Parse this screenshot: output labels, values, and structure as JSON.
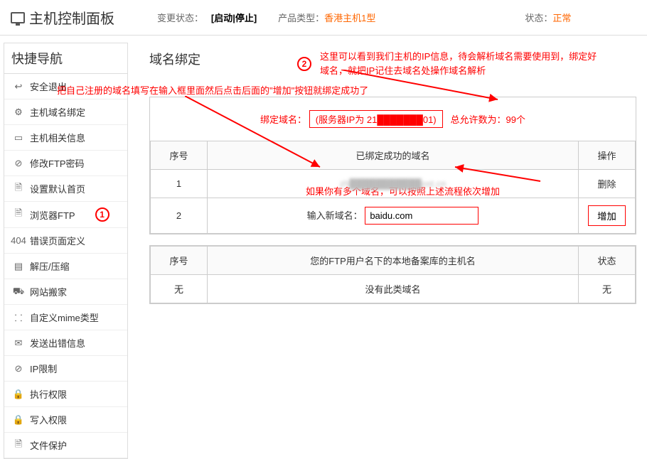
{
  "header": {
    "title": "主机控制面板",
    "change_label": "变更状态：",
    "change_value": "[启动|停止]",
    "ptype_label": "产品类型：",
    "ptype_value": "香港主机1型",
    "status_label": "状态：",
    "status_value": "正常"
  },
  "sidebar": {
    "title": "快捷导航",
    "items": [
      {
        "icon": "↩",
        "label": "安全退出"
      },
      {
        "icon": "⚙",
        "label": "主机域名绑定"
      },
      {
        "icon": "▭",
        "label": "主机相关信息"
      },
      {
        "icon": "⊘",
        "label": "修改FTP密码"
      },
      {
        "icon": "🗎",
        "label": "设置默认首页"
      },
      {
        "icon": "🗎",
        "label": "浏览器FTP"
      },
      {
        "icon": "404",
        "label": "错误页面定义"
      },
      {
        "icon": "▤",
        "label": "解压/压缩"
      },
      {
        "icon": "⛟",
        "label": "网站搬家"
      },
      {
        "icon": "⸬",
        "label": "自定义mime类型"
      },
      {
        "icon": "✉",
        "label": "发送出错信息"
      },
      {
        "icon": "⊘",
        "label": "IP限制"
      },
      {
        "icon": "🔒",
        "label": "执行权限"
      },
      {
        "icon": "🔒",
        "label": "写入权限"
      },
      {
        "icon": "🗎",
        "label": "文件保护"
      }
    ]
  },
  "main": {
    "title": "域名绑定",
    "bind_label": "绑定域名：",
    "bind_info": "(服务器IP为 21███████01)",
    "allow_label": "总允许数为：99个",
    "table1": {
      "h_sn": "序号",
      "h_domain": "已绑定成功的域名",
      "h_op": "操作",
      "row1_sn": "1",
      "row1_domain": "zh███████████ost.cn",
      "row1_op": "删除",
      "row2_sn": "2",
      "row2_label": "输入新域名：",
      "row2_value": "baidu.com",
      "row2_op": "增加"
    },
    "table2": {
      "h_sn": "序号",
      "h_domain": "您的FTP用户名下的本地备案库的主机名",
      "h_op": "状态",
      "none_sn": "无",
      "none_domain": "没有此类域名",
      "none_op": "无"
    }
  },
  "ann": {
    "n1": "1",
    "n2": "2",
    "t1": "把自己注册的域名填写在输入框里面然后点击后面的\"增加\"按钮就绑定成功了",
    "t2": "这里可以看到我们主机的IP信息，待会解析域名需要使用到，绑定好域名，就把IP记住去域名处操作域名解析",
    "t3": "如果你有多个域名，可以按照上述流程依次增加"
  }
}
